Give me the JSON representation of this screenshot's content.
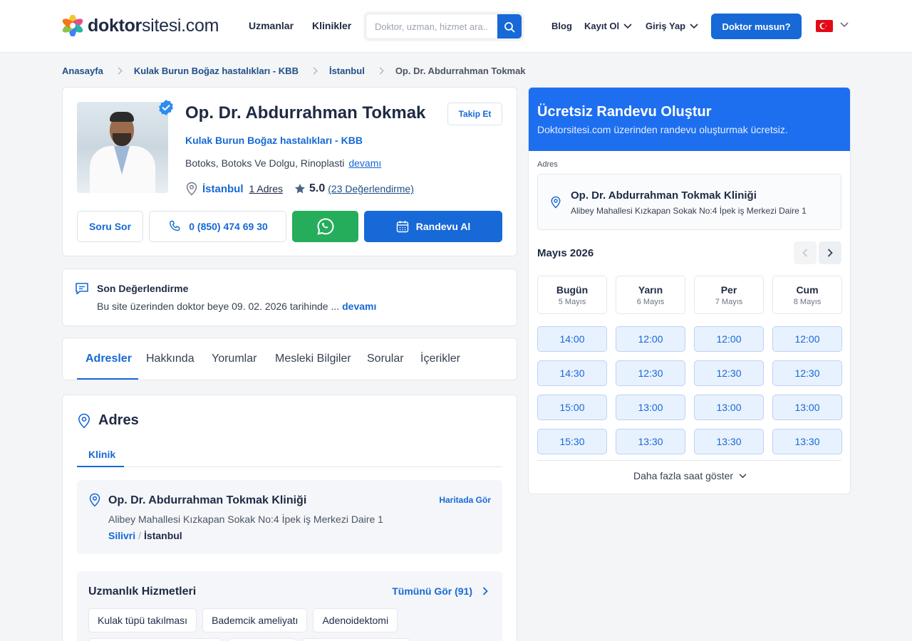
{
  "header": {
    "logo_main": "doktor",
    "logo_rest": "sitesi.com",
    "nav": [
      "Uzmanlar",
      "Klinikler"
    ],
    "search_placeholder": "Doktor, uzman, hizmet ara...",
    "blog": "Blog",
    "register": "Kayıt Ol",
    "login": "Giriş Yap",
    "doctor_cta": "Doktor musun?",
    "accent": "#1669d6"
  },
  "breadcrumb": [
    "Anasayfa",
    "Kulak Burun Boğaz hastalıkları - KBB",
    "İstanbul",
    "Op. Dr. Abdurrahman Tokmak"
  ],
  "profile": {
    "name": "Op. Dr. Abdurrahman Tokmak",
    "follow": "Takip Et",
    "specialty": "Kulak Burun Boğaz hastalıkları - KBB",
    "tags": "Botoks, Botoks Ve Dolgu, Rinoplasti",
    "tags_more": "devamı",
    "city": "İstanbul",
    "address_count": "1 Adres",
    "score": "5.0",
    "reviews": "(23 Değerlendirme)",
    "ask": "Soru Sor",
    "phone": "0 (850) 474 69 30",
    "appointment": "Randevu Al"
  },
  "last_review": {
    "title": "Son Değerlendirme",
    "text": "Bu site üzerinden doktor beye 09. 02. 2026 tarihinde ...",
    "more": "devamı"
  },
  "tabs": [
    "Adresler",
    "Hakkında",
    "Yorumlar",
    "Mesleki Bilgiler",
    "Sorular",
    "İçerikler"
  ],
  "address_section": {
    "title": "Adres",
    "subtab": "Klinik",
    "clinic_name": "Op. Dr. Abdurrahman Tokmak Kliniği",
    "map_link": "Haritada Gör",
    "clinic_address": "Alibey Mahallesi Kızkapan Sokak No:4 İpek iş Merkezi Daire 1",
    "district": "Silivri",
    "separator": "/",
    "city": "İstanbul",
    "services_title": "Uzmanlık Hizmetleri",
    "see_all": "Tümünü Gör (91)",
    "services": [
      "Kulak tüpü takılması",
      "Bademcik ameliyatı",
      "Adenoidektomi"
    ]
  },
  "appointment_panel": {
    "title": "Ücretsiz Randevu Oluştur",
    "subtitle": "Doktorsitesi.com üzerinden randevu oluşturmak ücretsiz.",
    "address_label": "Adres",
    "clinic_name": "Op. Dr. Abdurrahman Tokmak Kliniği",
    "clinic_address": "Alibey Mahallesi Kızkapan Sokak No:4 İpek iş Merkezi Daire 1",
    "month": "Mayıs 2026",
    "days": [
      {
        "name": "Bugün",
        "date": "5 Mayıs",
        "slots": [
          "14:00",
          "14:30",
          "15:00",
          "15:30"
        ]
      },
      {
        "name": "Yarın",
        "date": "6 Mayıs",
        "slots": [
          "12:00",
          "12:30",
          "13:00",
          "13:30"
        ]
      },
      {
        "name": "Per",
        "date": "7 Mayıs",
        "slots": [
          "12:00",
          "12:30",
          "13:00",
          "13:30"
        ]
      },
      {
        "name": "Cum",
        "date": "8 Mayıs",
        "slots": [
          "12:00",
          "12:30",
          "13:00",
          "13:30"
        ]
      }
    ],
    "more_hours": "Daha fazla saat göster",
    "header_color": "#1d6ff0"
  }
}
